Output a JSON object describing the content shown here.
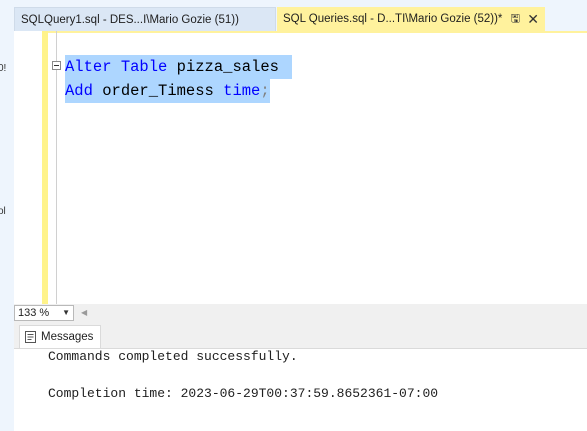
{
  "tabs": [
    {
      "label": "SQLQuery1.sql - DES...I\\Mario Gozie (51))",
      "active": false
    },
    {
      "label": "SQL Queries.sql - D...TI\\Mario Gozie (52))*",
      "active": true,
      "pin_icon": "pin-icon",
      "close_icon": "close-icon"
    }
  ],
  "left_strip": {
    "frag1": "0!",
    "frag2": "ol"
  },
  "editor": {
    "line1": {
      "kw1": "Alter",
      "kw2": "Table",
      "ident": "pizza_sales"
    },
    "line2": {
      "kw1": "Add",
      "ident": "order_Timess",
      "kw2": "time",
      "end": ";"
    }
  },
  "zoom": {
    "value": "133 %"
  },
  "results": {
    "tab_label": "Messages",
    "line1": "Commands completed successfully.",
    "line2": "Completion time: 2023-06-29T00:37:59.8652361-07:00"
  },
  "colors": {
    "keyword": "#0000ff",
    "selection": "#add6ff",
    "active_tab": "#fff29d",
    "tab_strip": "#eef5fd"
  }
}
